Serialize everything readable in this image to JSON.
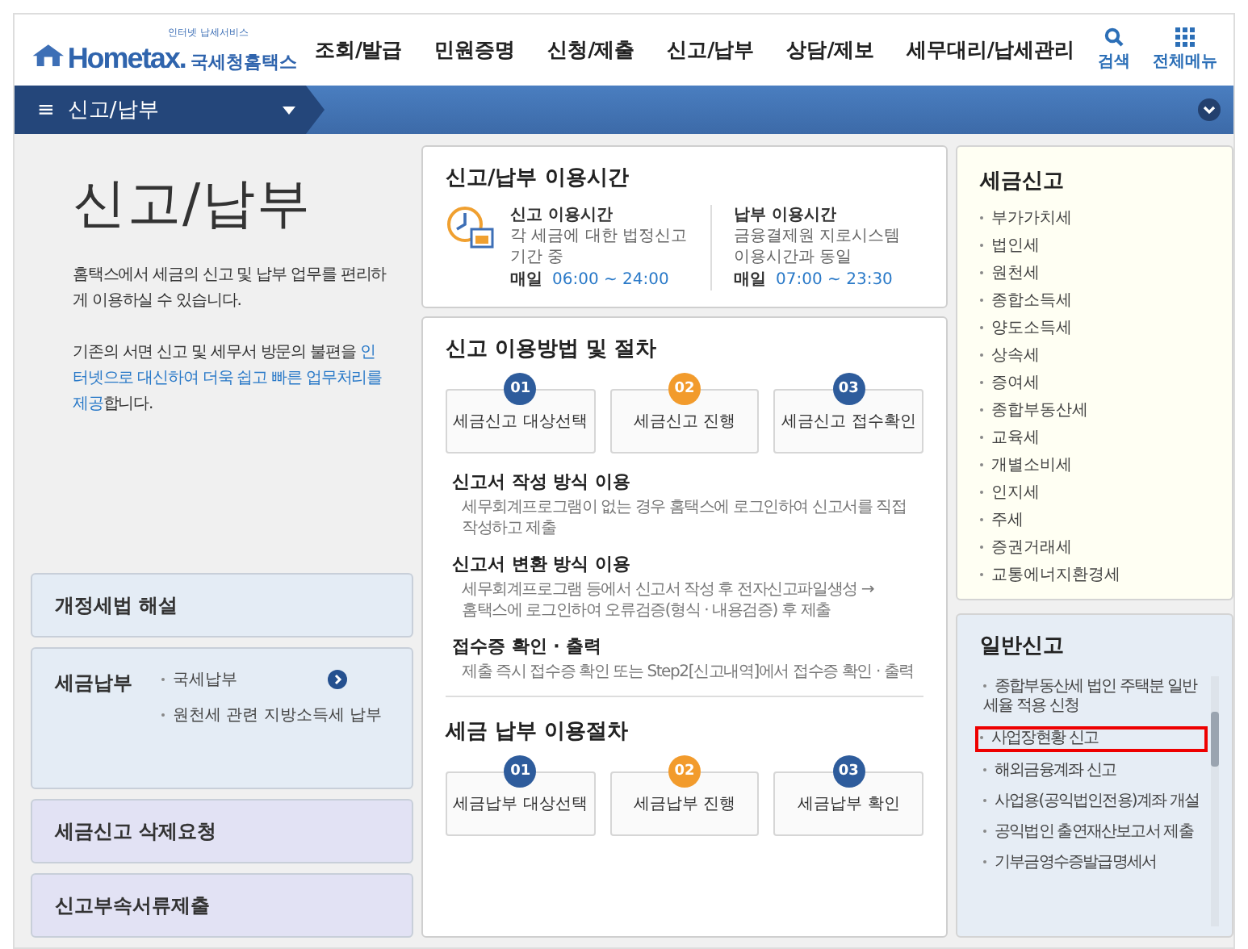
{
  "header": {
    "logo": {
      "tagline": "인터넷 납세서비스",
      "wordmark": "Hometax.",
      "name": "국세청홈택스"
    },
    "menu": [
      "조회/발급",
      "민원증명",
      "신청/제출",
      "신고/납부",
      "상담/제보",
      "세무대리/납세관리"
    ],
    "tools": [
      {
        "kind": "search",
        "label": "검색"
      },
      {
        "kind": "grid",
        "label": "전체메뉴"
      }
    ]
  },
  "location_bar": {
    "menu_label": "≡",
    "current": "신고/납부"
  },
  "intro": {
    "title": "신고/납부",
    "paragraphs": [
      [
        {
          "text": "홈택스에서 세금의 신고 및 납부 업무를 편리하게 이용하실 수 있습니다.",
          "highlight": false
        }
      ],
      [
        {
          "text": "기존의 서면 신고 및 세무서 방문의 불편을 ",
          "highlight": false
        },
        {
          "text": "인터넷으로 대신하여 더욱 쉽고 빠른 업무처리를 제공",
          "highlight": true
        },
        {
          "text": "합니다.",
          "highlight": false
        }
      ]
    ]
  },
  "left_boxes": [
    {
      "kind": "plain",
      "title": "개정세법 해설",
      "color": "#e4ecf5"
    },
    {
      "kind": "links",
      "title": "세금납부",
      "color": "#e4ecf5",
      "links": [
        "국세납부",
        "원천세 관련 지방소득세 납부"
      ]
    },
    {
      "kind": "plain",
      "title": "세금신고 삭제요청",
      "color": "#e2e2f4"
    },
    {
      "kind": "plain",
      "title": "신고부속서류제출",
      "color": "#e2e2f4"
    }
  ],
  "hours": {
    "title": "신고/납부 이용시간",
    "items": [
      {
        "title": "신고 이용시간",
        "lines": [
          "각 세금에 대한 법정신고",
          "기간 중"
        ],
        "day": "매일",
        "time": "06:00 ~ 24:00"
      },
      {
        "title": "납부 이용시간",
        "lines": [
          "금융결제원 지로시스템",
          "이용시간과 동일"
        ],
        "day": "매일",
        "time": "07:00 ~ 23:30"
      }
    ]
  },
  "filing": {
    "title": "신고 이용방법 및 절차",
    "steps": [
      {
        "number": "01",
        "label": "세금신고 대상선택",
        "color": "#2e5c9c"
      },
      {
        "number": "02",
        "label": "세금신고 진행",
        "color": "#f29b2c"
      },
      {
        "number": "03",
        "label": "세금신고 접수확인",
        "color": "#2e5c9c"
      }
    ],
    "methods": [
      {
        "title": "신고서 작성 방식 이용",
        "lines": [
          "세무회계프로그램이 없는 경우 홈택스에 로그인하여 신고서를 직접",
          "작성하고 제출"
        ]
      },
      {
        "title": "신고서 변환 방식 이용",
        "lines": [
          "세무회계프로그램 등에서 신고서 작성 후 전자신고파일생성 →",
          "홈택스에 로그인하여 오류검증(형식 · 내용검증) 후 제출"
        ]
      },
      {
        "title": "접수증 확인 · 출력",
        "lines": [
          "제출 즉시 접수증 확인 또는 Step2[신고내역]에서 접수증 확인 · 출력"
        ]
      }
    ]
  },
  "payment": {
    "title": "세금 납부 이용절차",
    "steps": [
      {
        "number": "01",
        "label": "세금납부 대상선택",
        "color": "#2e5c9c"
      },
      {
        "number": "02",
        "label": "세금납부 진행",
        "color": "#f29b2c"
      },
      {
        "number": "03",
        "label": "세금납부 확인",
        "color": "#2e5c9c"
      }
    ]
  },
  "tax_filing": {
    "title": "세금신고",
    "items": [
      "부가가치세",
      "법인세",
      "원천세",
      "종합소득세",
      "양도소득세",
      "상속세",
      "증여세",
      "종합부동산세",
      "교육세",
      "개별소비세",
      "인지세",
      "주세",
      "증권거래세",
      "교통에너지환경세"
    ]
  },
  "general_filing": {
    "title": "일반신고",
    "items": [
      {
        "label": "종합부동산세 법인 주택분 일반세율 적용 신청",
        "selected": false
      },
      {
        "label": "사업장현황 신고",
        "selected": true
      },
      {
        "label": "해외금융계좌 신고",
        "selected": false
      },
      {
        "label": "사업용(공익법인전용)계좌 개설",
        "selected": false
      },
      {
        "label": "공익법인 출연재산보고서 제출",
        "selected": false
      },
      {
        "label": "기부금영수증발급명세서",
        "selected": false
      }
    ]
  }
}
